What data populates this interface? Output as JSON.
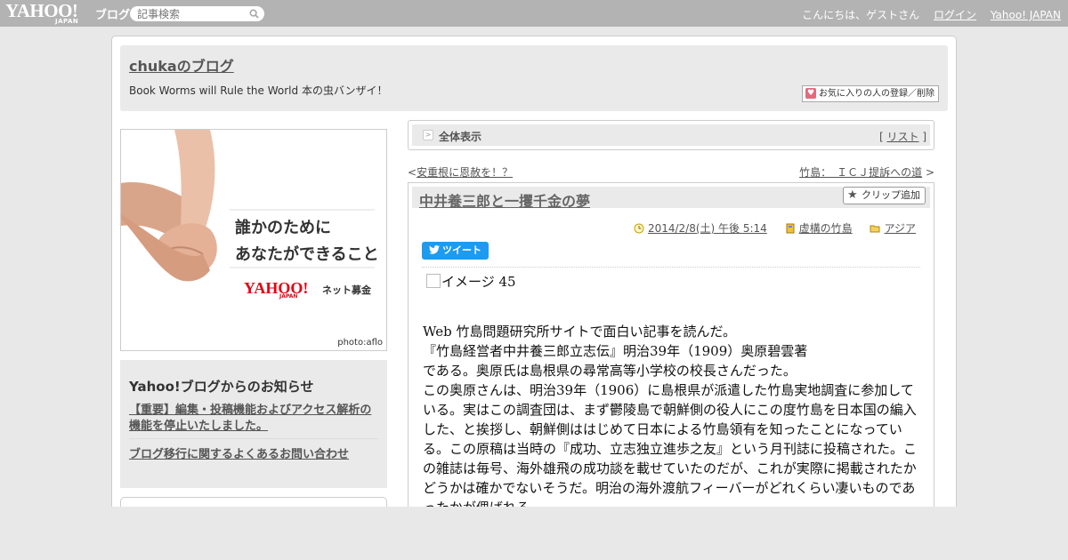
{
  "topbar": {
    "logo_text": "YAHOO!",
    "logo_sub": "JAPAN",
    "logo_blog": "ブログ",
    "search_placeholder": "記事検索",
    "greeting": "こんにちは、ゲストさん",
    "login": "ログイン",
    "yahoo_japan": "Yahoo! JAPAN"
  },
  "header": {
    "blog_title": "chukaのブログ",
    "description": "Book Worms will Rule the World 本の虫バンザイ！",
    "fav_button": "お気に入りの人の登録／削除"
  },
  "ad": {
    "line1": "誰かのために",
    "line2": "あなたができること",
    "brand": "YAHOO!",
    "brand_sub": "JAPAN",
    "service": "ネット募金",
    "credit": "photo:aflo"
  },
  "notice": {
    "heading": "Yahoo!ブログからのお知らせ",
    "item1": "【重要】編集・投稿機能およびアクセス解析の機能を停止いたしました。",
    "item2": "ブログ移行に関するよくあるお問い合わせ"
  },
  "viewbar": {
    "label": "全体表示",
    "list_link": "リスト",
    "bracket_open": "[",
    "bracket_close": "]"
  },
  "postnav": {
    "prev_mark": "<",
    "prev": "安重根に恩赦を！？",
    "next": "竹島：　ＩＣＪ提訴への道",
    "next_mark": ">"
  },
  "article": {
    "title": "中井養三郎と一攫千金の夢",
    "clip_button": "クリップ追加",
    "date": "2014/2/8(土) 午後 5:14",
    "category1": "虚構の竹島",
    "category2": "アジア",
    "tweet": "ツイート",
    "image_label": "イメージ 45",
    "paragraphs": [
      "Web 竹島問題研究所サイトで面白い記事を読んだ。",
      "『竹島経営者中井養三郎立志伝』明治39年（1909）奥原碧雲著",
      "である。奥原氏は島根県の尋常高等小学校の校長さんだった。",
      "この奥原さんは、明治39年（1906）に島根県が派遣した竹島実地調査に参加している。実はこの調査団は、まず鬱陵島で朝鮮側の役人にこの度竹島を日本国の編入した、と挨拶し、朝鮮側ははじめて日本による竹島領有を知ったことになっている。この原稿は当時の『成功、立志独立進歩之友』という月刊誌に投稿された。この雑誌は毎号、海外雄飛の成功談を載せていたのだが、これが実際に掲載されたかどうかは確かでないそうだ。明治の海外渡航フィーバーがどれくらい凄いものであったかが偲ばれる。"
    ]
  },
  "colors": {
    "topbar": "#b3b3b3",
    "tweet": "#1d9bf0",
    "ad_brand": "#e60012"
  }
}
